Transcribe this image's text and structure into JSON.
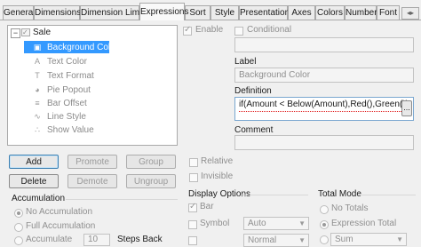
{
  "tabs": [
    {
      "label": "General"
    },
    {
      "label": "Dimensions"
    },
    {
      "label": "Dimension Limits"
    },
    {
      "label": "Expressions"
    },
    {
      "label": "Sort"
    },
    {
      "label": "Style"
    },
    {
      "label": "Presentation"
    },
    {
      "label": "Axes"
    },
    {
      "label": "Colors"
    },
    {
      "label": "Number"
    },
    {
      "label": "Font"
    }
  ],
  "tree": {
    "root": "Sale",
    "items": [
      {
        "label": "Background Color",
        "icon": "paint-bucket-icon",
        "glyph": "▣"
      },
      {
        "label": "Text Color",
        "icon": "text-color-icon",
        "glyph": "A"
      },
      {
        "label": "Text Format",
        "icon": "text-format-icon",
        "glyph": "T"
      },
      {
        "label": "Pie Popout",
        "icon": "pie-icon",
        "glyph": "◕"
      },
      {
        "label": "Bar Offset",
        "icon": "bar-offset-icon",
        "glyph": "≡"
      },
      {
        "label": "Line Style",
        "icon": "line-style-icon",
        "glyph": "∿"
      },
      {
        "label": "Show Value",
        "icon": "show-value-icon",
        "glyph": "∴"
      }
    ]
  },
  "buttons": {
    "add": "Add",
    "promote": "Promote",
    "group": "Group",
    "delete": "Delete",
    "demote": "Demote",
    "ungroup": "Ungroup",
    "browse": "..."
  },
  "accumulation": {
    "title": "Accumulation",
    "no_accumulation": "No Accumulation",
    "full_accumulation": "Full Accumulation",
    "accumulate": "Accumulate",
    "steps_value": "10",
    "steps_label": "Steps Back"
  },
  "expression": {
    "enable": "Enable",
    "conditional": "Conditional",
    "label_title": "Label",
    "label_value": "Background Color",
    "definition_title": "Definition",
    "definition_value": "if(Amount < Below(Amount),Red(),Green())",
    "comment_title": "Comment",
    "relative": "Relative",
    "invisible": "Invisible"
  },
  "display_options": {
    "title": "Display Options",
    "bar": "Bar",
    "symbol": "Symbol",
    "symbol_value": "Auto",
    "line_value": "Normal"
  },
  "total_mode": {
    "title": "Total Mode",
    "no_totals": "No Totals",
    "expression_total": "Expression Total",
    "sum_value": "Sum"
  },
  "colors": {
    "selection": "#3399ff",
    "background": "#f0f0f0",
    "error_underline": "#e02020"
  }
}
